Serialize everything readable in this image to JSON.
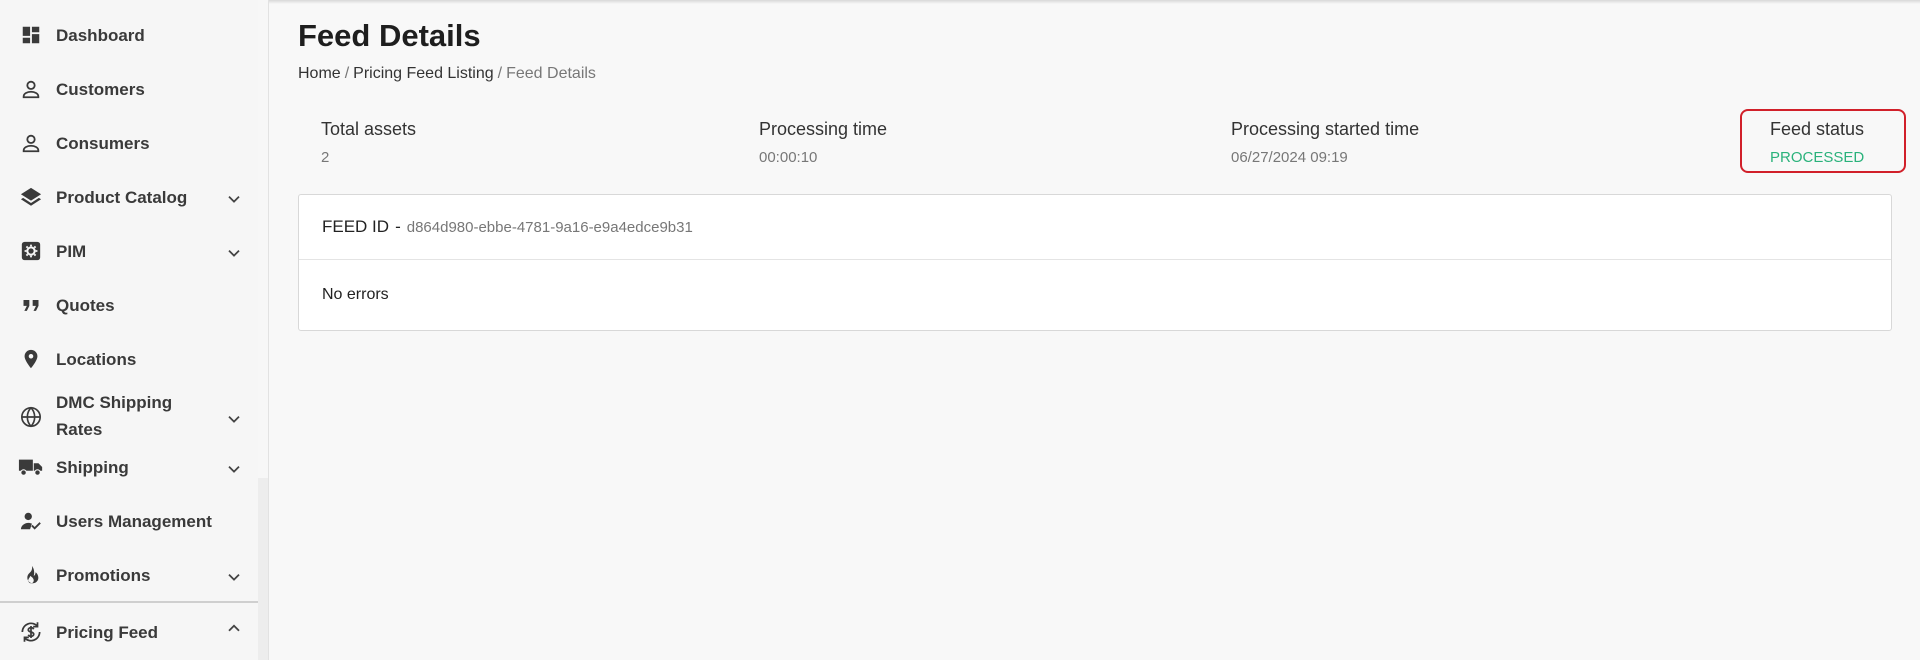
{
  "sidebar": {
    "items": [
      {
        "label": "Dashboard",
        "icon": "dashboard-icon",
        "expandable": false
      },
      {
        "label": "Customers",
        "icon": "person-icon",
        "expandable": false
      },
      {
        "label": "Consumers",
        "icon": "person-icon",
        "expandable": false
      },
      {
        "label": "Product Catalog",
        "icon": "layers-icon",
        "expandable": true
      },
      {
        "label": "PIM",
        "icon": "gear-box-icon",
        "expandable": true
      },
      {
        "label": "Quotes",
        "icon": "quote-icon",
        "expandable": false
      },
      {
        "label": "Locations",
        "icon": "location-pin-icon",
        "expandable": false
      },
      {
        "label_line1": "DMC Shipping",
        "label_line2": "Rates",
        "icon": "globe-icon",
        "expandable": true
      },
      {
        "label": "Shipping",
        "icon": "truck-icon",
        "expandable": true
      },
      {
        "label": "Users Management",
        "icon": "user-check-icon",
        "expandable": false
      },
      {
        "label": "Promotions",
        "icon": "flame-icon",
        "expandable": true
      },
      {
        "label": "Pricing Feed",
        "icon": "dollar-cycle-icon",
        "expandable": true,
        "expanded": true
      }
    ]
  },
  "page": {
    "title": "Feed Details",
    "breadcrumb": {
      "home": "Home",
      "listing": "Pricing Feed Listing",
      "current": "Feed Details",
      "separator": "/"
    }
  },
  "stats": {
    "total_assets": {
      "label": "Total assets",
      "value": "2"
    },
    "processing_time": {
      "label": "Processing time",
      "value": "00:00:10"
    },
    "processing_started": {
      "label": "Processing started time",
      "value": "06/27/2024 09:19"
    },
    "feed_status": {
      "label": "Feed status",
      "value": "PROCESSED"
    }
  },
  "feed": {
    "id_label": "FEED ID",
    "dash": "-",
    "id_value": "d864d980-ebbe-4781-9a16-e9a4edce9b31",
    "errors_text": "No errors"
  },
  "colors": {
    "status_processed": "#2ab27b",
    "highlight_border": "#d1202a",
    "sidebar_bg": "#f6f6f6"
  }
}
